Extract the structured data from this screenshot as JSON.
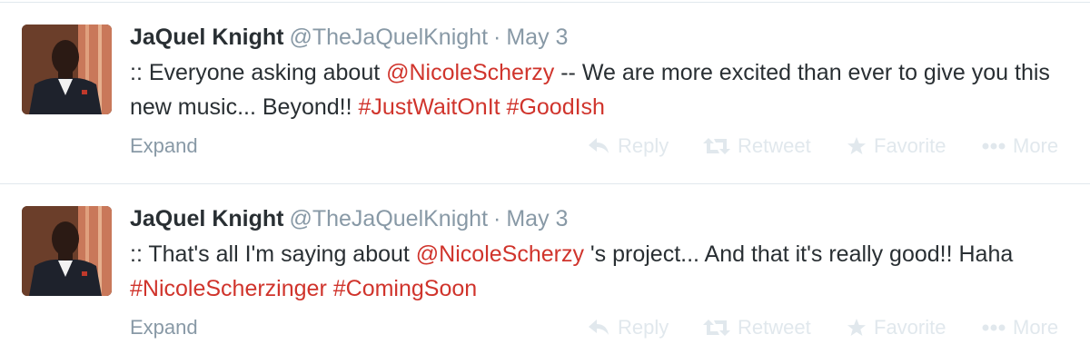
{
  "tweets": [
    {
      "fullname": "JaQuel Knight",
      "username": "@TheJaQuelKnight",
      "separator": "·",
      "time": "May 3",
      "text": [
        {
          "t": ":: Everyone asking about ",
          "hl": false
        },
        {
          "t": "@NicoleScherzy",
          "hl": true
        },
        {
          "t": " -- We are more excited than ever to give you this new music... Beyond!! ",
          "hl": false
        },
        {
          "t": "#JustWaitOnIt",
          "hl": true
        },
        {
          "t": " ",
          "hl": false
        },
        {
          "t": "#GoodIsh",
          "hl": true
        }
      ],
      "expand_label": "Expand",
      "actions": {
        "reply": "Reply",
        "retweet": "Retweet",
        "favorite": "Favorite",
        "more": "More"
      }
    },
    {
      "fullname": "JaQuel Knight",
      "username": "@TheJaQuelKnight",
      "separator": "·",
      "time": "May 3",
      "text": [
        {
          "t": ":: That's all I'm saying about ",
          "hl": false
        },
        {
          "t": "@NicoleScherzy",
          "hl": true
        },
        {
          "t": " 's project... And that it's really good!! Haha ",
          "hl": false
        },
        {
          "t": "#NicoleScherzinger",
          "hl": true
        },
        {
          "t": " ",
          "hl": false
        },
        {
          "t": "#ComingSoon",
          "hl": true
        }
      ],
      "expand_label": "Expand",
      "actions": {
        "reply": "Reply",
        "retweet": "Retweet",
        "favorite": "Favorite",
        "more": "More"
      }
    }
  ],
  "colors": {
    "link": "#d0342c",
    "name": "#292f33",
    "meta": "#8899a6",
    "action": "#e1e8ed"
  },
  "icons": {
    "avatar": "profile-photo",
    "reply": "reply-arrow-icon",
    "retweet": "retweet-icon",
    "favorite": "star-icon",
    "more": "ellipsis-icon"
  }
}
